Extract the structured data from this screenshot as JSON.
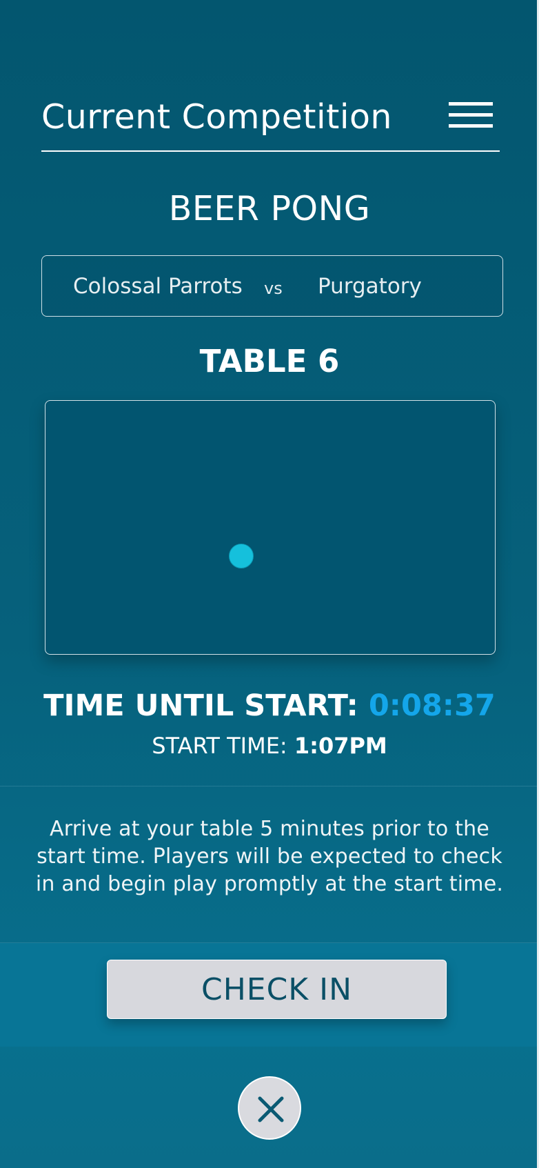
{
  "header": {
    "title": "Current Competition",
    "menu_icon": "hamburger-menu-icon"
  },
  "game": {
    "name": "BEER PONG",
    "team_a": "Colossal Parrots",
    "versus": "vs",
    "team_b": "Purgatory",
    "table": "TABLE 6"
  },
  "timing": {
    "countdown_label": "TIME UNTIL START:",
    "countdown_value": "0:08:37",
    "start_label": "START TIME:",
    "start_value": "1:07PM"
  },
  "note": "Arrive at your table 5 minutes prior to the start time. Players will be expected to check in and begin play promptly at the start time.",
  "actions": {
    "check_in_label": "CHECK IN",
    "close_icon": "close-icon"
  },
  "colors": {
    "background": "#06617c",
    "accent": "#14a6ea",
    "location_dot": "#15c0dc",
    "button": "#d7d8dd"
  }
}
